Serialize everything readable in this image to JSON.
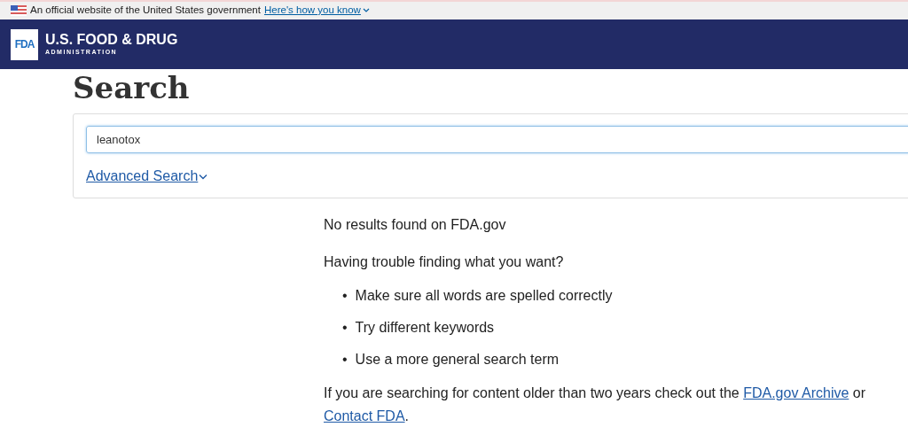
{
  "gov_banner": {
    "text": "An official website of the United States government",
    "link": "Here's how you know"
  },
  "header": {
    "logo": "FDA",
    "title": "U.S. FOOD & DRUG",
    "subtitle": "ADMINISTRATION"
  },
  "page_title": "Search",
  "search": {
    "value": "leanotox",
    "advanced_link": "Advanced Search"
  },
  "results": {
    "message": "No results found on FDA.gov",
    "help_heading": "Having trouble finding what you want?",
    "tips": [
      {
        "marker": "•",
        "text": "Make sure all words are spelled correctly"
      },
      {
        "marker": "•",
        "text": "Try different keywords"
      },
      {
        "marker": "•",
        "text": "Use a more general search term"
      }
    ],
    "footer_text": "If you are searching for content older than two years check out the",
    "archive_link": "FDA.gov Archive",
    "or_text": "or",
    "contact_link": "Contact FDA",
    "end_text": "."
  }
}
